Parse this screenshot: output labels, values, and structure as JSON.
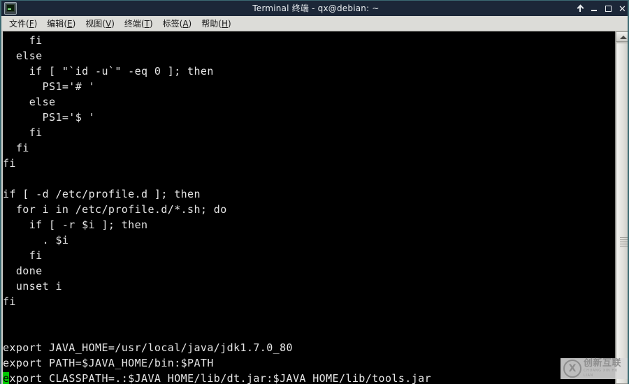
{
  "window": {
    "title": "Terminal 终端 - qx@debian: ~",
    "icon": "terminal-icon",
    "controls": {
      "shade_label": "",
      "minimize_label": "",
      "maximize_label": "",
      "close_label": "✕"
    },
    "colors": {
      "titlebar_bg": "#1c2738",
      "menubar_bg": "#dcdcd8",
      "terminal_bg": "#000000",
      "terminal_fg": "#e6e6e6",
      "cursor_bg": "#00c800",
      "window_border": "#3c6a72"
    }
  },
  "menubar": {
    "items": [
      {
        "label": "文件",
        "mnemonic": "F"
      },
      {
        "label": "编辑",
        "mnemonic": "E"
      },
      {
        "label": "视图",
        "mnemonic": "V"
      },
      {
        "label": "终端",
        "mnemonic": "T"
      },
      {
        "label": "标签",
        "mnemonic": "A"
      },
      {
        "label": "帮助",
        "mnemonic": "H"
      }
    ]
  },
  "terminal": {
    "lines": [
      "    fi",
      "  else",
      "    if [ \"`id -u`\" -eq 0 ]; then",
      "      PS1='# '",
      "    else",
      "      PS1='$ '",
      "    fi",
      "  fi",
      "fi",
      "",
      "if [ -d /etc/profile.d ]; then",
      "  for i in /etc/profile.d/*.sh; do",
      "    if [ -r $i ]; then",
      "      . $i",
      "    fi",
      "  done",
      "  unset i",
      "fi",
      "",
      "",
      "export JAVA_HOME=/usr/local/java/jdk1.7.0_80",
      "export PATH=$JAVA_HOME/bin:$PATH"
    ],
    "cursor_line": {
      "cursor_char": "e",
      "rest": "xport CLASSPATH=.:$JAVA_HOME/lib/dt.jar:$JAVA_HOME/lib/tools.jar"
    }
  },
  "scrollbar": {
    "up_arrow": "scroll-up-arrow",
    "thumb": "scroll-thumb"
  },
  "watermark": {
    "cn": "创新互联",
    "en": "CHUANG XIN HU LIAN"
  }
}
